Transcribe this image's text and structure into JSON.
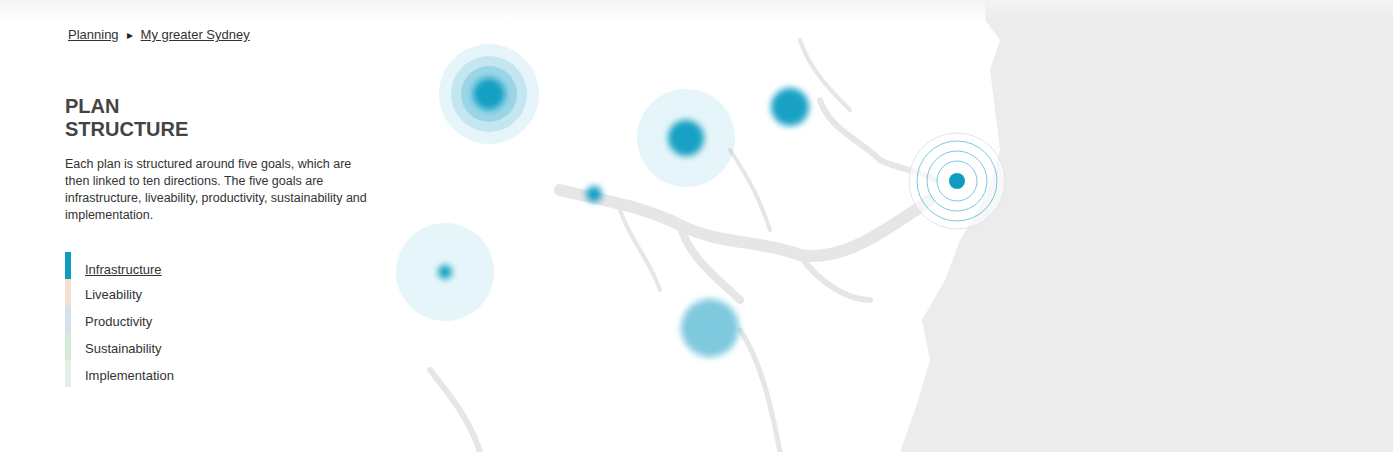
{
  "breadcrumb": {
    "items": [
      "Planning",
      "My greater Sydney"
    ],
    "separator": "▸"
  },
  "title": [
    "PLAN",
    "STRUCTURE"
  ],
  "description": "Each plan is structured around five goals, which are then linked to ten directions. The five goals are infrastructure, liveability, productivity, sustainability and implementation.",
  "goals": [
    {
      "label": "Infrastructure",
      "selected": true,
      "color": "#0e9dc2"
    },
    {
      "label": "Liveability",
      "selected": false,
      "color": "#f6ddd2"
    },
    {
      "label": "Productivity",
      "selected": false,
      "color": "#d6e1ed"
    },
    {
      "label": "Sustainability",
      "selected": false,
      "color": "#d6ead8"
    },
    {
      "label": "Implementation",
      "selected": false,
      "color": "#e7eee7"
    }
  ]
}
